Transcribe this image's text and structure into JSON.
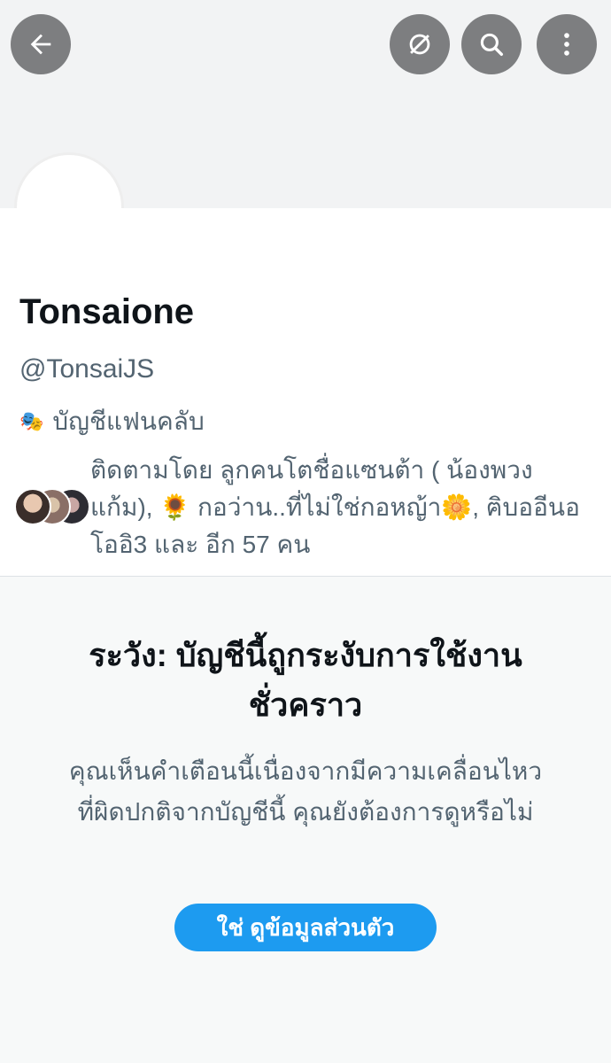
{
  "header": {
    "back_icon": "arrow-left-icon",
    "actions": [
      "hide-icon",
      "search-icon",
      "more-vertical-icon"
    ]
  },
  "profile": {
    "name": "Tonsaione",
    "handle": "@TonsaiJS",
    "category_icon": "theater-mask-icon",
    "category": "บัญชีแฟนคลับ",
    "followed_by": "ติดตามโดย ลูกคนโตชื่อแซนต้า ( น้องพวงแก้ม), 🌻 กอว่าน..ที่ไม่ใช่กอหญ้า🌼, ฅิบออีนอโออิ3 และ อีก 57 คน"
  },
  "warning": {
    "title": "ระวัง: บัญชีนี้ถูกระงับการใช้งานชั่วคราว",
    "description": "คุณเห็นคำเตือนนี้เนื่องจากมีความเคลื่อนไหวที่ผิดปกติจากบัญชีนี้ คุณยังต้องการดูหรือไม่",
    "button_label": "ใช่ ดูข้อมูลส่วนตัว"
  },
  "colors": {
    "accent": "#1d9bf0",
    "icon_button_bg": "#7d7e80",
    "secondary_text": "#536471"
  }
}
